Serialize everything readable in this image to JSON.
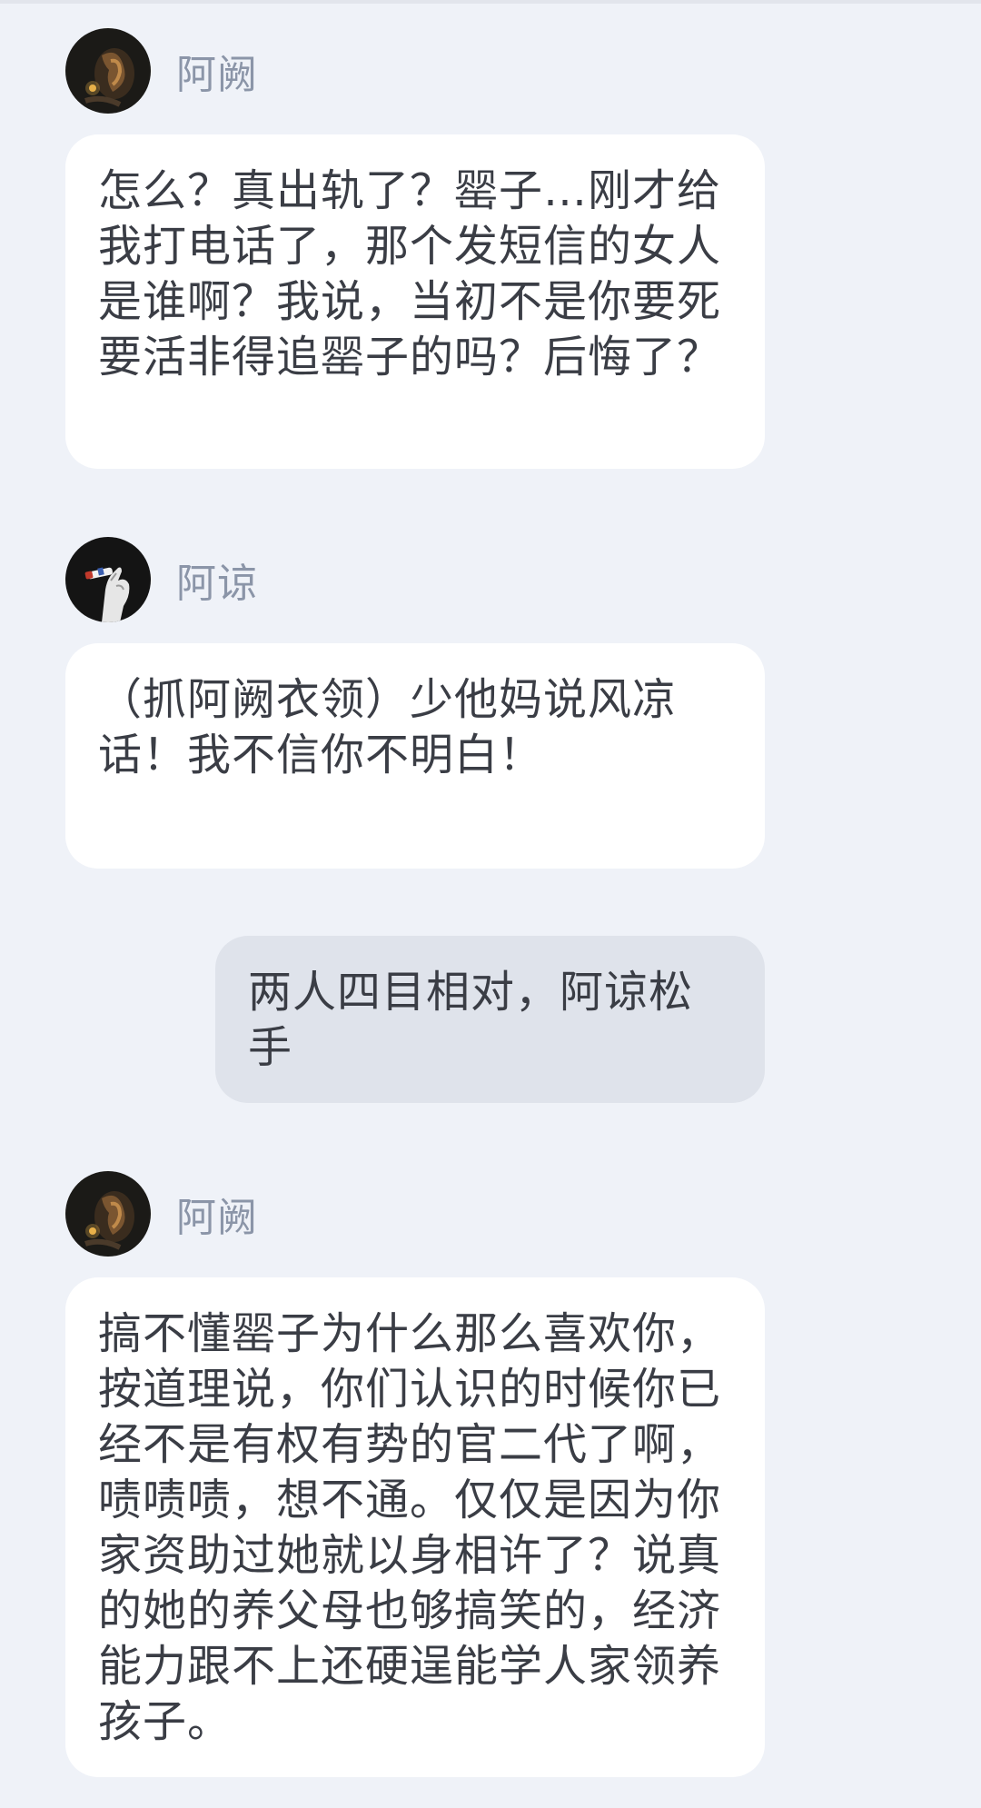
{
  "messages": [
    {
      "sender": "阿阙",
      "avatar_icon": "dark-smoke-avatar-icon",
      "text": "怎么？真出轨了？罂子…刚才给我打电话了，那个发短信的女人是谁啊？我说，当初不是你要死要活非得追罂子的吗？后悔了？"
    },
    {
      "sender": "阿谅",
      "avatar_icon": "hand-cigarette-avatar-icon",
      "text": "（抓阿阙衣领）少他妈说风凉话！我不信你不明白！"
    },
    {
      "sender": "",
      "self": true,
      "text": "两人四目相对，阿谅松手"
    },
    {
      "sender": "阿阙",
      "avatar_icon": "dark-smoke-avatar-icon",
      "text": "搞不懂罂子为什么那么喜欢你，按道理说，你们认识的时候你已经不是有权有势的官二代了啊，啧啧啧，想不通。仅仅是因为你家资助过她就以身相许了？说真的她的养父母也够搞笑的，经济能力跟不上还硬逞能学人家领养孩子。"
    }
  ],
  "colors": {
    "background": "#eff2f8",
    "bubble_other": "#ffffff",
    "bubble_self": "#dfe3eb",
    "sender_name": "#8b95a8",
    "message_text": "#3a3d45"
  }
}
